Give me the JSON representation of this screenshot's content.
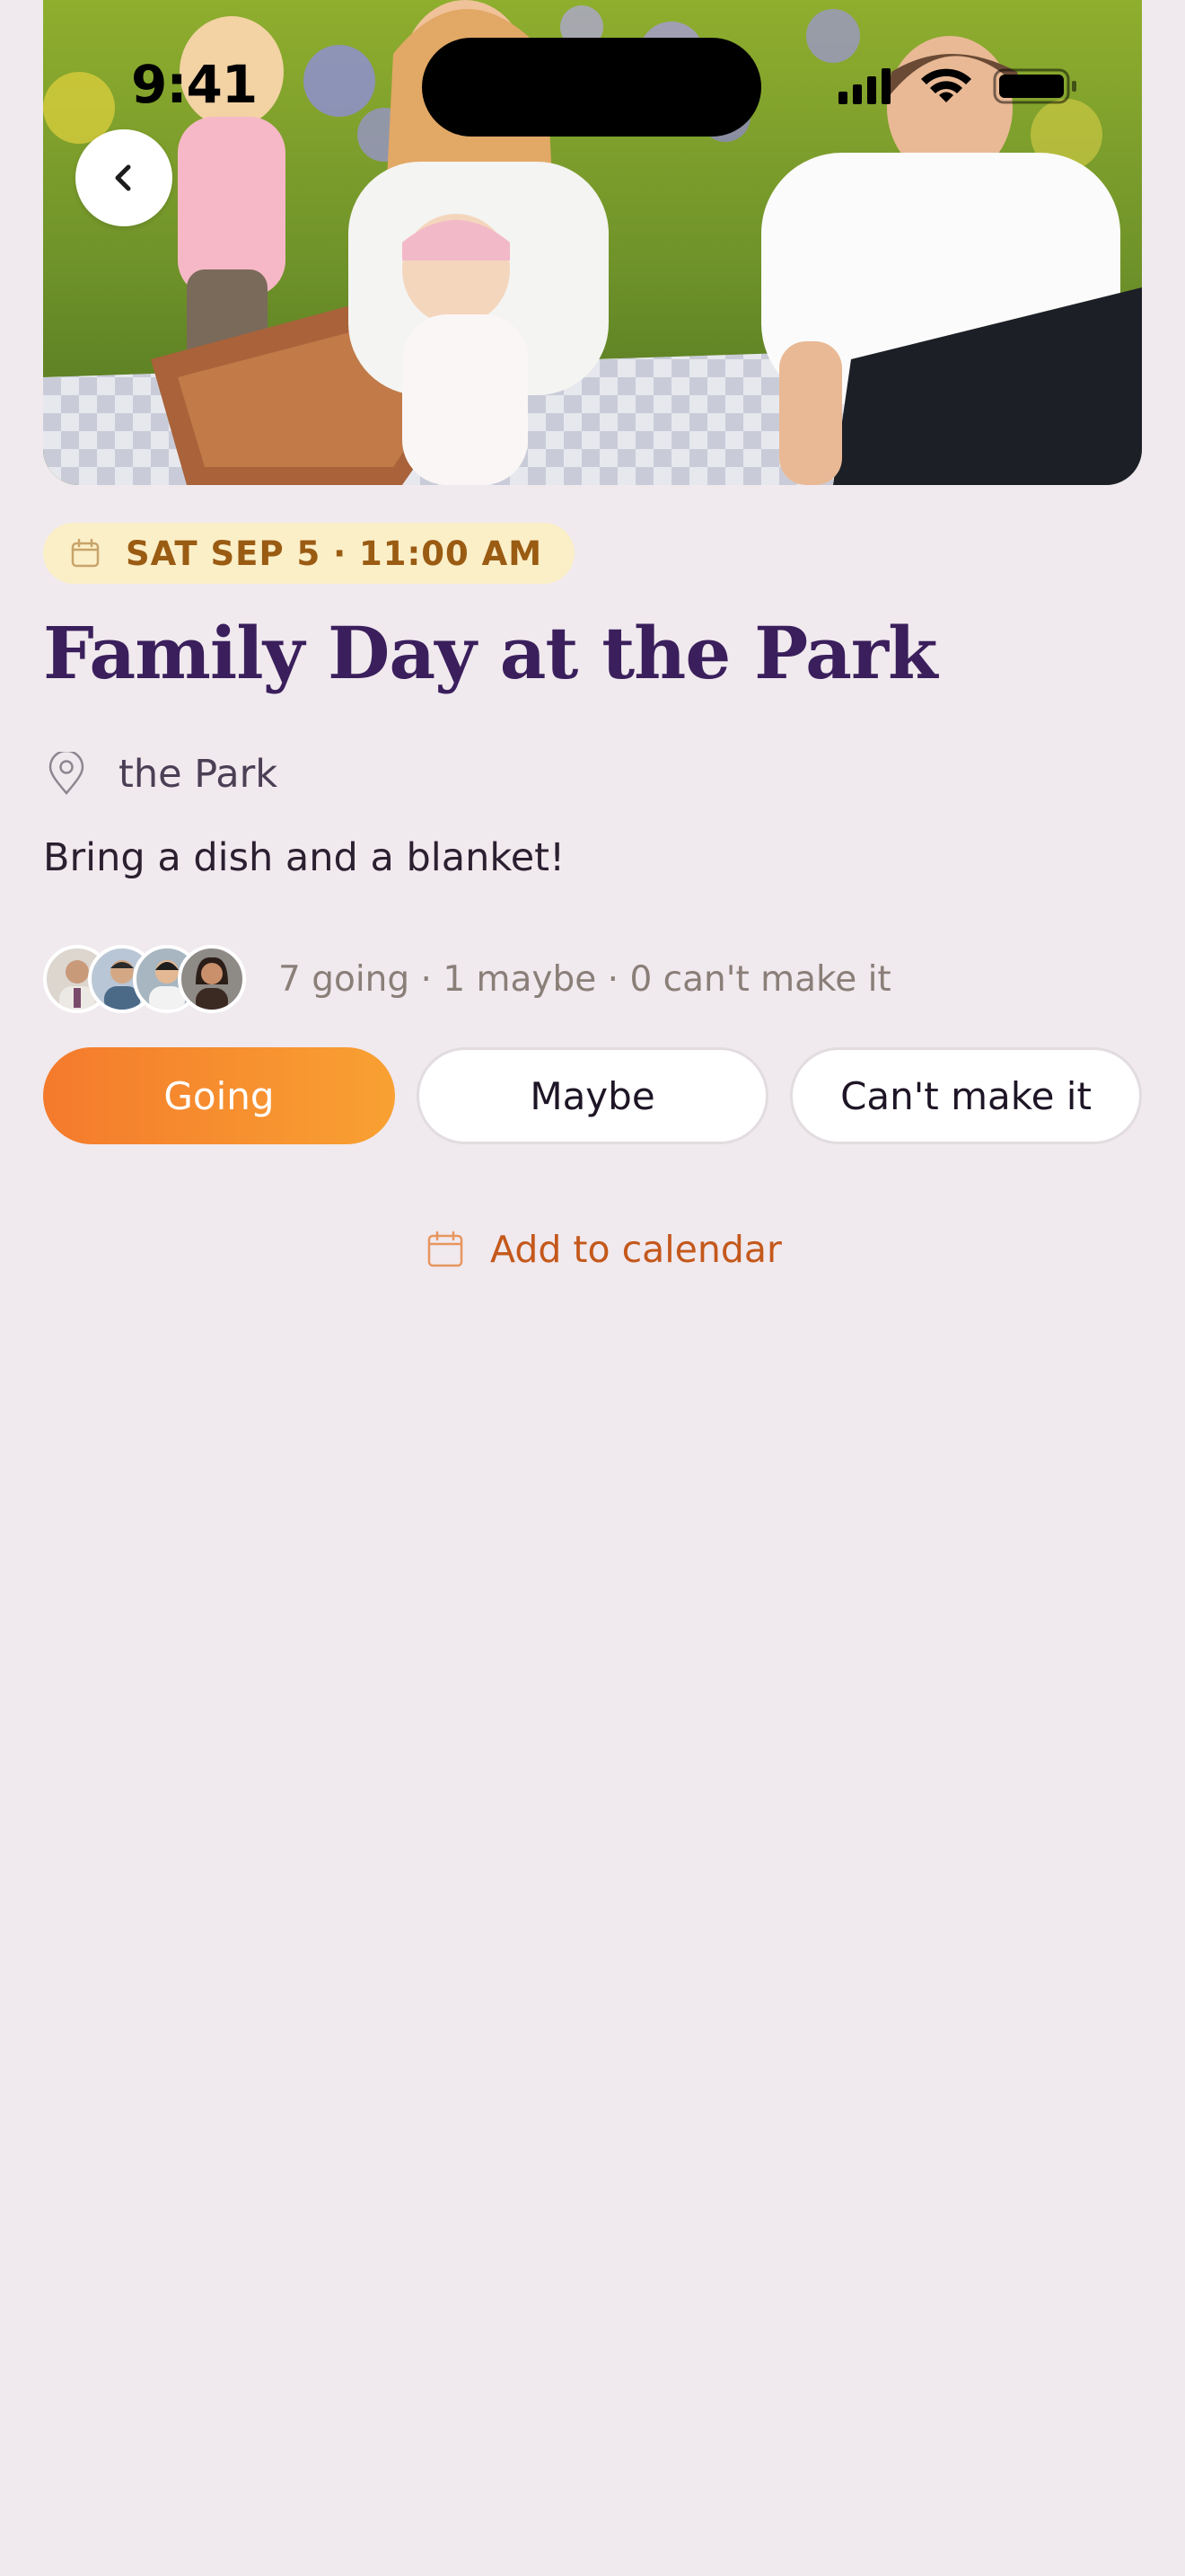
{
  "status_bar": {
    "time": "9:41"
  },
  "hero": {
    "image_alt": "Family picnic photo"
  },
  "header": {
    "back_icon": "chevron-left-icon"
  },
  "event": {
    "date_label": "SAT SEP 5 · 11:00 AM",
    "date_icon": "calendar-icon",
    "title": "Family Day at the Park",
    "location_icon": "map-pin-icon",
    "location": "the Park",
    "description": "Bring a dish and a blanket!",
    "attendee_summary": "7 going · 1 maybe · 0 can't make it"
  },
  "rsvp": {
    "going_label": "Going",
    "maybe_label": "Maybe",
    "cant_label": "Can't make it",
    "selected": "Going"
  },
  "actions": {
    "add_to_calendar_label": "Add to calendar",
    "add_to_calendar_icon": "calendar-icon"
  },
  "colors": {
    "background": "#f0e9ee",
    "title": "#3a1f5c",
    "accent_orange": "#f47a2c",
    "accent_amber": "#f9a132",
    "chip_bg": "#fbefc8",
    "chip_text": "#9a5b12",
    "link": "#c4581b"
  }
}
